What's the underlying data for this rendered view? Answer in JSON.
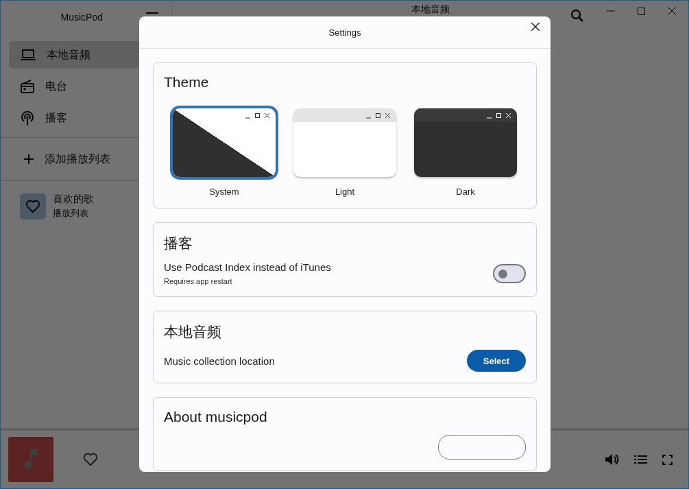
{
  "app": {
    "title": "MusicPod"
  },
  "sidebar": {
    "items": [
      {
        "label": "本地音频",
        "kind": "local",
        "selected": true
      },
      {
        "label": "电台",
        "kind": "radio",
        "selected": false
      },
      {
        "label": "播客",
        "kind": "podcast",
        "selected": false
      }
    ],
    "add_playlist": "添加播放列表",
    "playlists": [
      {
        "title": "喜欢的歌",
        "subtitle": "播放列表"
      }
    ]
  },
  "header": {
    "title": "本地音频"
  },
  "settings": {
    "title": "Settings",
    "theme": {
      "title": "Theme",
      "options": [
        {
          "label": "System",
          "kind": "system",
          "selected": true
        },
        {
          "label": "Light",
          "kind": "light",
          "selected": false
        },
        {
          "label": "Dark",
          "kind": "dark",
          "selected": false
        }
      ]
    },
    "podcast": {
      "title": "播客",
      "setting": "Use Podcast Index instead of iTunes",
      "note": "Requires app restart",
      "on": false
    },
    "local_audio": {
      "title": "本地音频",
      "setting": "Music collection location",
      "button": "Select"
    },
    "about": {
      "title": "About musicpod"
    }
  }
}
